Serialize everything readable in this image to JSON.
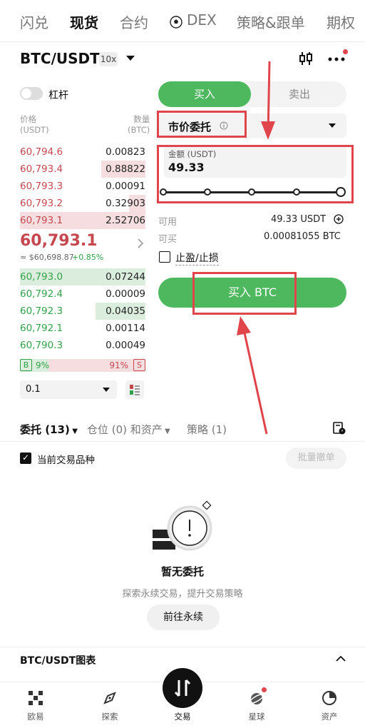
{
  "top_tabs": [
    "闪兑",
    "现货",
    "合约",
    "DEX",
    "策略&跟单",
    "期权"
  ],
  "header": {
    "pair": "BTC/USDT",
    "leverage": "10x",
    "margin_label": "杠杆"
  },
  "orderbook": {
    "price_header": "价格",
    "price_unit": "(USDT)",
    "qty_header": "数量",
    "qty_unit": "(BTC)",
    "asks": [
      {
        "price": "60,794.6",
        "qty": "0.00823",
        "depth": 0.0
      },
      {
        "price": "60,793.4",
        "qty": "0.88822",
        "depth": 0.35
      },
      {
        "price": "60,793.3",
        "qty": "0.00091",
        "depth": 0.0
      },
      {
        "price": "60,793.2",
        "qty": "0.32903",
        "depth": 0.13
      },
      {
        "price": "60,793.1",
        "qty": "2.52706",
        "depth": 1.0
      }
    ],
    "last_price": "60,793.1",
    "index_price": "≈ $60,698.87",
    "change": "+0.85%",
    "bids": [
      {
        "price": "60,793.0",
        "qty": "0.07244",
        "depth": 1.0
      },
      {
        "price": "60,792.4",
        "qty": "0.00009",
        "depth": 0.0
      },
      {
        "price": "60,792.3",
        "qty": "0.04035",
        "depth": 0.4
      },
      {
        "price": "60,792.1",
        "qty": "0.00114",
        "depth": 0.0
      },
      {
        "price": "60,790.3",
        "qty": "0.00049",
        "depth": 0.0
      }
    ],
    "buy_label": "B",
    "buy_ratio": "9%",
    "sell_ratio": "91%",
    "sell_label": "S",
    "precision": "0.1"
  },
  "trade_form": {
    "buy_tab": "买入",
    "sell_tab": "卖出",
    "order_type": "市价委托",
    "amount_label": "金额 (USDT)",
    "amount_value": "49.33",
    "slider_fraction": 1.0,
    "available_label": "可用",
    "available_value": "49.33 USDT",
    "can_buy_label": "可买",
    "can_buy_value": "0.00081055 BTC",
    "tpsl_label": "止盈/止损",
    "submit_label": "买入 BTC"
  },
  "orders": {
    "tabs": [
      "委托 (13)",
      "仓位 (0) 和资产",
      "策略 (1)"
    ],
    "current_symbol_label": "当前交易品种",
    "batch_cancel": "批量撤单",
    "empty_title": "暂无委托",
    "empty_subtitle": "探索永续交易，提升交易策略",
    "goto_button": "前往永续"
  },
  "chart_section": {
    "title": "BTC/USDT图表"
  },
  "bottom_nav": [
    "欧易",
    "探索",
    "交易",
    "星球",
    "资产"
  ],
  "colors": {
    "accent_green": "#4db85d",
    "ask_red": "#c5484e",
    "bid_green": "#33a14a",
    "annotation_red": "#e0454b"
  }
}
